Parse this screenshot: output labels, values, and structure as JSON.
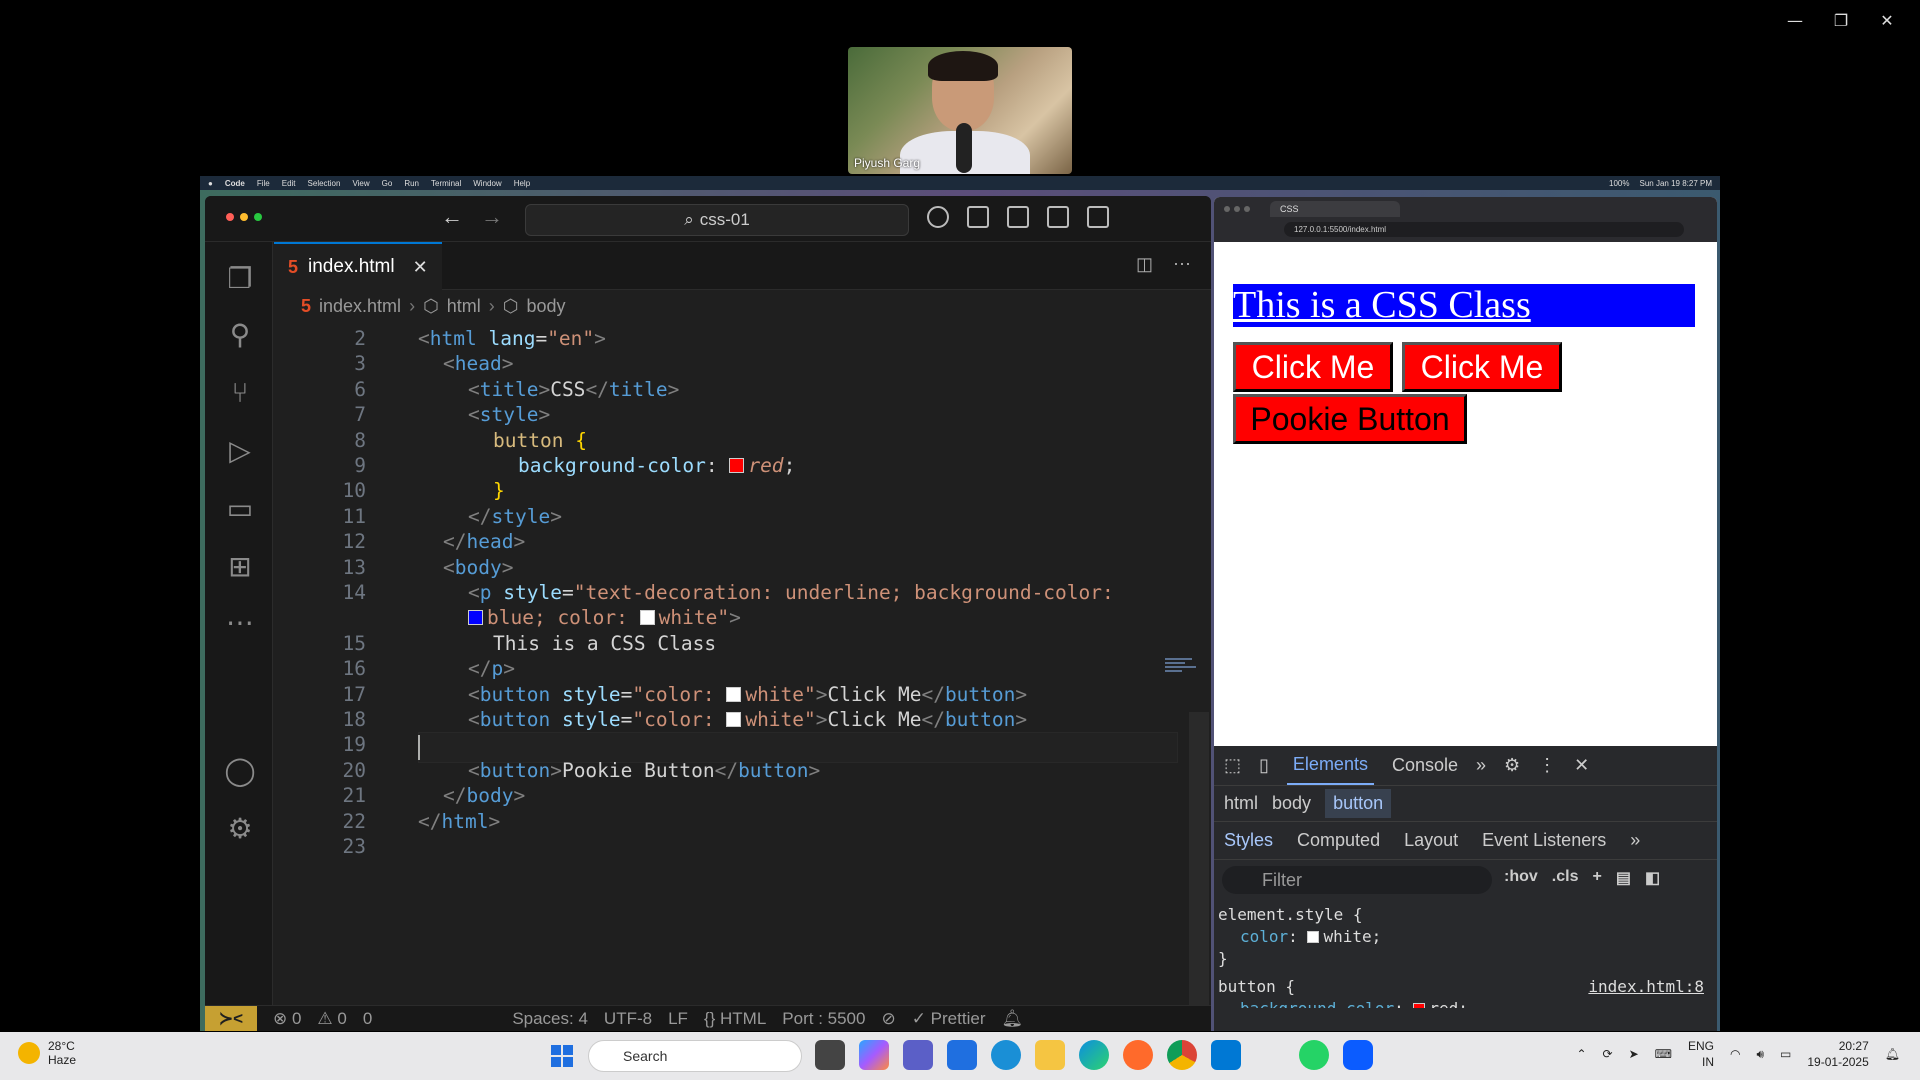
{
  "zoom": {
    "participant_name": "Piyush Garg",
    "controls": [
      "—",
      "❐",
      "✕"
    ]
  },
  "mac_menubar": {
    "apple": "",
    "items": [
      "Code",
      "File",
      "Edit",
      "Selection",
      "View",
      "Go",
      "Run",
      "Terminal",
      "Window",
      "Help"
    ],
    "right": [
      "100%",
      "Sun Jan 19  8:27 PM"
    ]
  },
  "vscode": {
    "command_center": "css-01",
    "tab_label": "index.html",
    "breadcrumb": [
      "index.html",
      "html",
      "body"
    ],
    "lines": [
      {
        "n": "2",
        "html": "<span class='t'>&lt;</span><span class='tg'>html</span> <span class='at'>lang</span>=<span class='st'>\"en\"</span><span class='t'>&gt;</span>",
        "indent": 0
      },
      {
        "n": "3",
        "html": "<span class='t'>&lt;</span><span class='tg'>head</span><span class='t'>&gt;</span>",
        "indent": 1
      },
      {
        "n": "6",
        "html": "<span class='t'>&lt;</span><span class='tg'>title</span><span class='t'>&gt;</span>CSS<span class='t'>&lt;/</span><span class='tg'>title</span><span class='t'>&gt;</span>",
        "indent": 2
      },
      {
        "n": "7",
        "html": "<span class='t'>&lt;</span><span class='tg'>style</span><span class='t'>&gt;</span>",
        "indent": 2
      },
      {
        "n": "8",
        "html": "<span class='br' style='color:#d7ba7d'>button</span> <span class='br'>{</span>",
        "indent": 3
      },
      {
        "n": "9",
        "html": "<span class='pr'>background-color</span>: <span class='sw' style='background:red'></span><span class='vl'>red</span>;",
        "indent": 4
      },
      {
        "n": "10",
        "html": "<span class='br'>}</span>",
        "indent": 3
      },
      {
        "n": "11",
        "html": "<span class='t'>&lt;/</span><span class='tg'>style</span><span class='t'>&gt;</span>",
        "indent": 2
      },
      {
        "n": "12",
        "html": "<span class='t'>&lt;/</span><span class='tg'>head</span><span class='t'>&gt;</span>",
        "indent": 1
      },
      {
        "n": "13",
        "html": "<span class='t'>&lt;</span><span class='tg'>body</span><span class='t'>&gt;</span>",
        "indent": 1
      },
      {
        "n": "14",
        "html": "<span class='t'>&lt;</span><span class='tg'>p</span> <span class='at'>style</span>=<span class='st'>\"text-decoration: underline; background-color:</span>",
        "indent": 2
      },
      {
        "n": "",
        "html": "<span class='sw' style='background:blue'></span><span class='st'>blue; color: </span><span class='sw' style='background:white'></span><span class='st'>white\"</span><span class='t'>&gt;</span>",
        "indent": 2
      },
      {
        "n": "15",
        "html": "This is a CSS Class",
        "indent": 3
      },
      {
        "n": "16",
        "html": "<span class='t'>&lt;/</span><span class='tg'>p</span><span class='t'>&gt;</span>",
        "indent": 2
      },
      {
        "n": "17",
        "html": "<span class='t'>&lt;</span><span class='tg'>button</span> <span class='at'>style</span>=<span class='st'>\"color: </span><span class='sw' style='background:white'></span><span class='st'>white\"</span><span class='t'>&gt;</span>Click Me<span class='t'>&lt;/</span><span class='tg'>button</span><span class='t'>&gt;</span>",
        "indent": 2
      },
      {
        "n": "18",
        "html": "<span class='t'>&lt;</span><span class='tg'>button</span> <span class='at'>style</span>=<span class='st'>\"color: </span><span class='sw' style='background:white'></span><span class='st'>white\"</span><span class='t'>&gt;</span>Click Me<span class='t'>&lt;/</span><span class='tg'>button</span><span class='t'>&gt;</span>",
        "indent": 2
      },
      {
        "n": "19",
        "html": "",
        "indent": 0,
        "current": true
      },
      {
        "n": "20",
        "html": "<span class='t'>&lt;</span><span class='tg'>button</span><span class='t'>&gt;</span>Pookie Button<span class='t'>&lt;/</span><span class='tg'>button</span><span class='t'>&gt;</span>",
        "indent": 2
      },
      {
        "n": "21",
        "html": "<span class='t'>&lt;/</span><span class='tg'>body</span><span class='t'>&gt;</span>",
        "indent": 1
      },
      {
        "n": "22",
        "html": "<span class='t'>&lt;/</span><span class='tg'>html</span><span class='t'>&gt;</span>",
        "indent": 0
      },
      {
        "n": "23",
        "html": "",
        "indent": 0
      }
    ],
    "status": {
      "errors": "⊗ 0",
      "warnings": "⚠ 0",
      "ports": "0",
      "spaces": "Spaces: 4",
      "encoding": "UTF-8",
      "eol": "LF",
      "language": "{} HTML",
      "port": "Port : 5500",
      "prettier": "✓ Prettier"
    }
  },
  "browser": {
    "tab_title": "CSS",
    "url": "127.0.0.1:5500/index.html",
    "paragraph": "This is a CSS Class",
    "buttons": [
      "Click Me",
      "Click Me",
      "Pookie Button"
    ]
  },
  "devtools": {
    "tabs": [
      "Elements",
      "Console",
      "»"
    ],
    "crumbs": [
      "html",
      "body",
      "button"
    ],
    "subtabs": [
      "Styles",
      "Computed",
      "Layout",
      "Event Listeners",
      "»"
    ],
    "filter_placeholder": "Filter",
    "tools": [
      ":hov",
      ".cls",
      "+"
    ],
    "rule1_selector": "element.style {",
    "rule1_prop": "color",
    "rule1_value": "white;",
    "rule1_close": "}",
    "rule2_selector": "button {",
    "rule2_link": "index.html:8",
    "rule2_prop": "background-color",
    "rule2_value": "red;"
  },
  "taskbar": {
    "temp": "28°C",
    "condition": "Haze",
    "search": "Search",
    "lang1": "ENG",
    "lang2": "IN",
    "time": "20:27",
    "date": "19-01-2025"
  }
}
